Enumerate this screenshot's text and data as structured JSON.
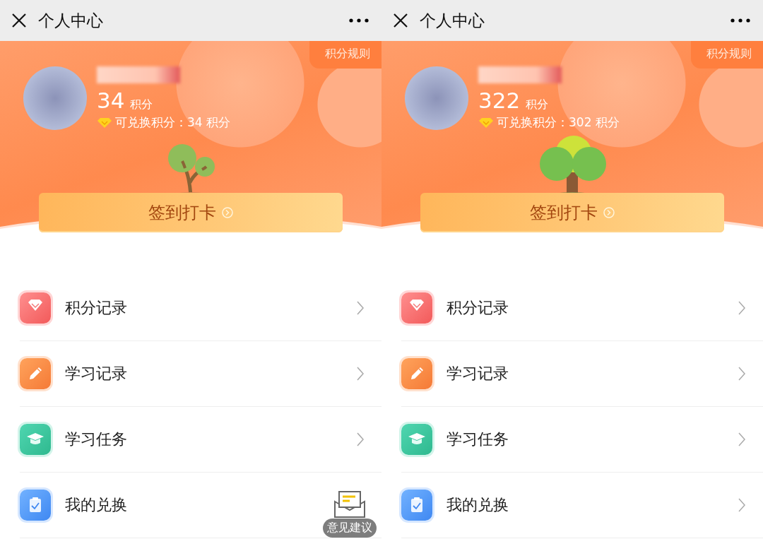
{
  "screens": [
    {
      "title": "个人中心",
      "rules_label": "积分规则",
      "points": "34",
      "points_unit": "积分",
      "redeemable": "可兑换积分：34 积分",
      "tree": {
        "kind": "sapling"
      },
      "checkin_label": "签到打卡",
      "menu": [
        {
          "label": "积分记录",
          "kind": "diamond",
          "chevron": true
        },
        {
          "label": "学习记录",
          "kind": "pencil",
          "chevron": true
        },
        {
          "label": "学习任务",
          "kind": "cap",
          "chevron": true
        },
        {
          "label": "我的兑换",
          "kind": "clipboard",
          "chevron": false
        }
      ],
      "feedback": {
        "label": "意见建议"
      }
    },
    {
      "title": "个人中心",
      "rules_label": "积分规则",
      "points": "322",
      "points_unit": "积分",
      "redeemable": "可兑换积分：302 积分",
      "tree": {
        "kind": "tree"
      },
      "checkin_label": "签到打卡",
      "menu": [
        {
          "label": "积分记录",
          "kind": "diamond",
          "chevron": true
        },
        {
          "label": "学习记录",
          "kind": "pencil",
          "chevron": true
        },
        {
          "label": "学习任务",
          "kind": "cap",
          "chevron": true
        },
        {
          "label": "我的兑换",
          "kind": "clipboard",
          "chevron": true
        }
      ]
    }
  ]
}
